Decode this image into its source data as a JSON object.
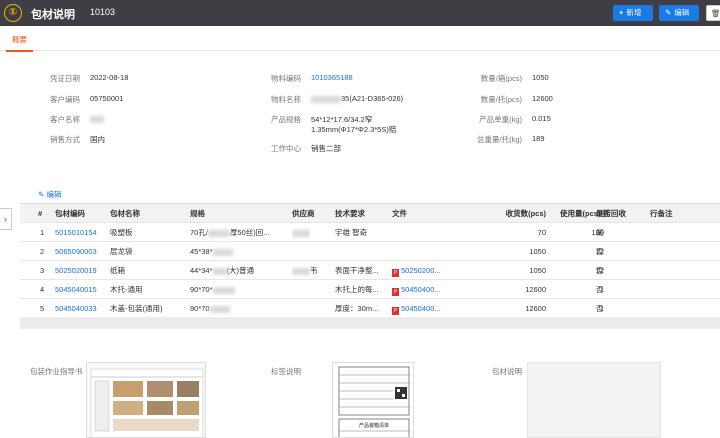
{
  "header": {
    "logo_glyph": "①",
    "title": "包材说明",
    "code": "10103",
    "new_label": "新增",
    "edit_label": "编辑",
    "delete_glyph": "🗑"
  },
  "tabs": [
    {
      "label": "概要"
    }
  ],
  "details": {
    "voucher_date": {
      "label": "凭证日期",
      "value": "2022-08-18"
    },
    "customer_code": {
      "label": "客户编码",
      "value": "05750001"
    },
    "customer_name": {
      "label": "客户名称",
      "value": ""
    },
    "sales_mode": {
      "label": "销售方式",
      "value": "国内"
    },
    "material_code": {
      "label": "物料编码",
      "value": "1010365188"
    },
    "material_name": {
      "label": "物料名称",
      "value": "35(A21-D365-026)"
    },
    "product_spec": {
      "label": "产品规格",
      "line1": "54*12*17.6/34.2窄",
      "line2": "1.35mm(Φ17*Φ2.3*5S)赔"
    },
    "work_center": {
      "label": "工作中心",
      "value": "销售二部"
    },
    "qty_per_box": {
      "label": "数量/箱(pcs)",
      "value": "1050"
    },
    "qty_per_pallet": {
      "label": "数量/托(pcs)",
      "value": "12600"
    },
    "unit_weight": {
      "label": "产品单重(kg)",
      "value": "0.015"
    },
    "total_weight": {
      "label": "总重量/托(kg)",
      "value": "189"
    }
  },
  "side_toggle": "›",
  "edit_link": "编辑",
  "table": {
    "columns": [
      "#",
      "包材编码",
      "包材名称",
      "规格",
      "供应商",
      "技术要求",
      "文件",
      "收货数(pcs)",
      "使用量(pcs)/托",
      "是否回收",
      "行备注"
    ],
    "rows": [
      {
        "idx": "1",
        "code": "5015010154",
        "name": "吸塑板",
        "spec": "70孔/",
        "spec2": "厚50丝)回...",
        "supplier": "",
        "tech": "宇雄 智奇",
        "file": "",
        "recv": "70",
        "usage": "180",
        "recycle": "是",
        "note": ""
      },
      {
        "idx": "2",
        "code": "5065090003",
        "name": "层龙袋",
        "spec": "45*38*",
        "spec2": "",
        "supplier": "",
        "tech": "",
        "file": "",
        "recv": "1050",
        "usage": "12",
        "recycle": "否",
        "note": ""
      },
      {
        "idx": "3",
        "code": "5025020019",
        "name": "纸箱",
        "spec": "44*34*",
        "spec2": "(大)普通",
        "supplier": "韦",
        "tech": "表面干净整...",
        "file": "50250200...",
        "recv": "1050",
        "usage": "12",
        "recycle": "否",
        "note": ""
      },
      {
        "idx": "4",
        "code": "5045040015",
        "name": "木托-通用",
        "spec": "90*70*",
        "spec2": "",
        "supplier": "",
        "tech": "木托上的每...",
        "file": "50450400...",
        "recv": "12600",
        "usage": "1",
        "recycle": "否",
        "note": ""
      },
      {
        "idx": "5",
        "code": "5045040033",
        "name": "木盖-包装(通用)",
        "spec": "90*70",
        "spec2": "",
        "supplier": "",
        "tech": "厚度：30m...",
        "file": "50450400...",
        "recv": "12600",
        "usage": "1",
        "recycle": "否",
        "note": ""
      }
    ]
  },
  "images": {
    "guide_label": "包装作业指导书",
    "label_label": "标签说明",
    "material_label": "包材说明",
    "label_doc_title": "产品装箱清单"
  },
  "colors": {
    "accent": "#1a7be6",
    "tab_active": "#e65a1e",
    "topbar": "#3e3e44"
  }
}
